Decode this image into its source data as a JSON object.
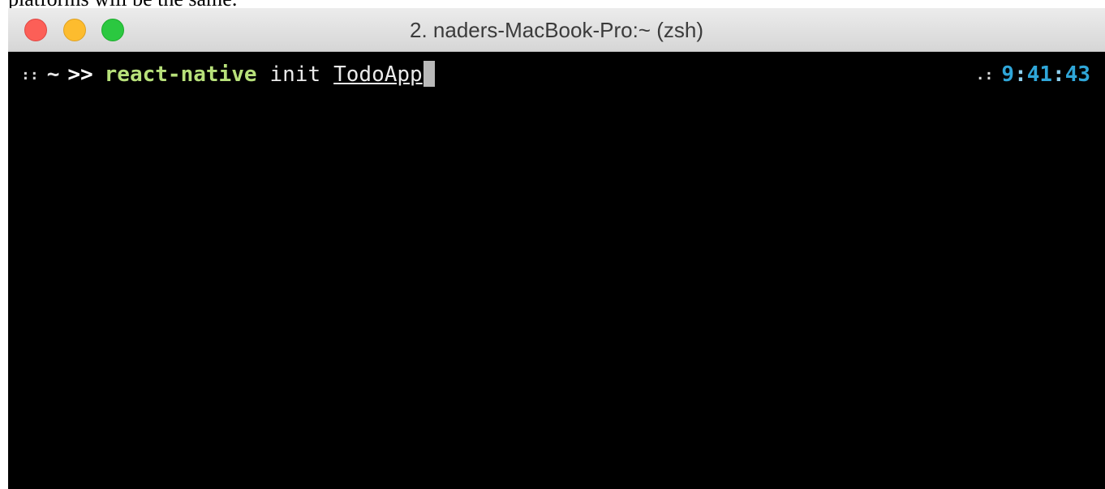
{
  "caption": "platforms will be the same.",
  "window": {
    "title": "2. naders-MacBook-Pro:~ (zsh)",
    "buttons": {
      "close": "close",
      "minimize": "minimize",
      "zoom": "zoom"
    }
  },
  "terminal": {
    "prompt": {
      "marker": "::",
      "directory": "~",
      "arrow": ">>"
    },
    "command": {
      "name": "react-native",
      "subcommand": "init",
      "argument": "TodoApp"
    },
    "right_prompt": {
      "marker": ".:",
      "hours": "9",
      "minutes": "41",
      "seconds": "43"
    }
  },
  "colors": {
    "close": "#fc5f57",
    "minimize": "#fdbc2e",
    "zoom": "#2bc840",
    "command": "#b7e07a",
    "clock": "#2fa6d8",
    "background": "#000000"
  }
}
